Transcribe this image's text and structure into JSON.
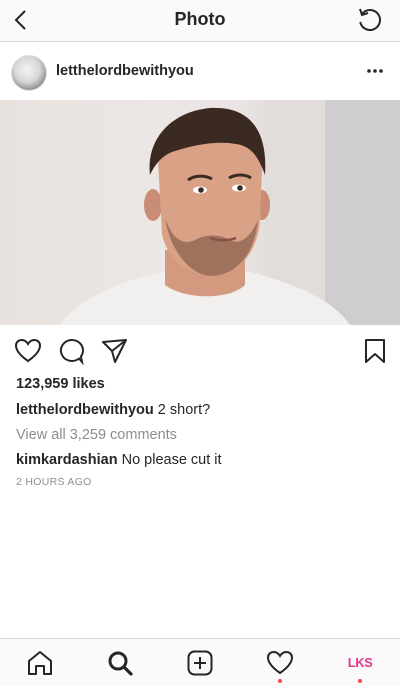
{
  "header": {
    "title": "Photo"
  },
  "post": {
    "username": "letthelordbewithyou",
    "likes": "123,959 likes",
    "caption_user": "letthelordbewithyou",
    "caption_text": "2 short?",
    "view_all": "View all 3,259 comments",
    "comment_user": "kimkardashian",
    "comment_text": "No please cut it",
    "timestamp": "2 HOURS AGO"
  },
  "tabbar": {
    "profile_label": "LKS",
    "icons": [
      "home-icon",
      "search-icon",
      "new-post-icon",
      "activity-heart-icon",
      "profile-icon"
    ]
  },
  "colors": {
    "notification": "#ed4956",
    "profile_accent": "#e3368f",
    "muted": "#8e8e8e"
  }
}
